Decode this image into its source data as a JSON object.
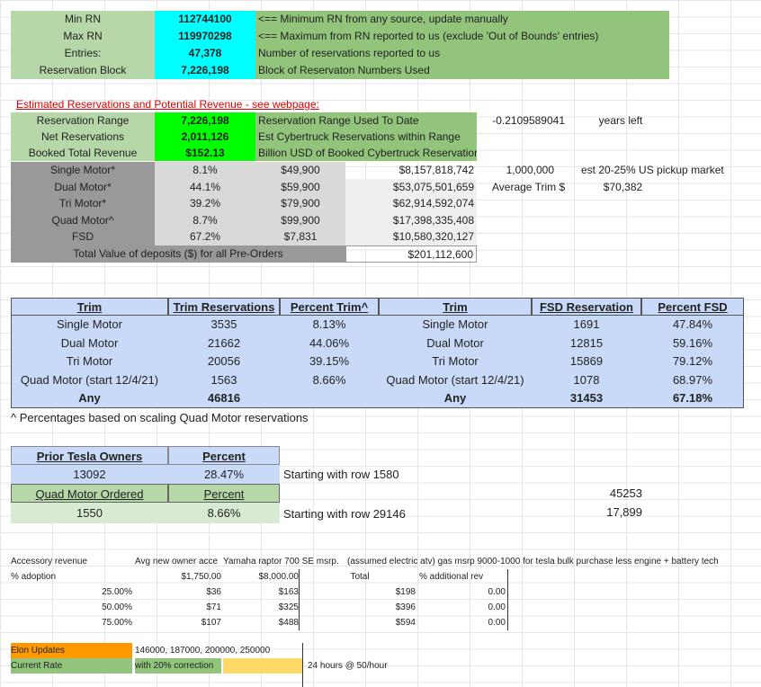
{
  "summary": {
    "rows": [
      {
        "label": "Min RN",
        "value": "112744100",
        "note": "<== Minimum RN from any source, update manually"
      },
      {
        "label": "Max RN",
        "value": "119970298",
        "note": "<== Maximum from RN reported to us (exclude 'Out of Bounds' entries)"
      },
      {
        "label": "Entries:",
        "value": "47,378",
        "note": "Number of reservations reported to us"
      },
      {
        "label": "Reservation Block",
        "value": "7,226,198",
        "note": "Block of Reservaton Numbers Used"
      }
    ]
  },
  "estimate": {
    "title": "Estimated Reservations and Potential Revenue - see webpage:",
    "rows": [
      {
        "label": "Reservation Range",
        "value": "7,226,198",
        "note": "Reservation Range Used To Date"
      },
      {
        "label": "Net Reservations",
        "value": "2,011,126",
        "note": "Est Cybertruck Reservations within Range"
      },
      {
        "label": "Booked Total Revenue",
        "value": "$152.13",
        "note": "Billion USD of Booked Cybertruck Reservation"
      }
    ],
    "side": {
      "years_value": "-0.2109589041",
      "years_label": "years left",
      "market_count": "1,000,000",
      "market_note": "est 20-25% US pickup market",
      "avg_trim_label": "Average Trim $",
      "avg_trim_value": "$70,382"
    },
    "trims": [
      {
        "name": "Single Motor*",
        "pct": "8.1%",
        "price": "$49,900",
        "revenue": "$8,157,818,742"
      },
      {
        "name": "Dual Motor*",
        "pct": "44.1%",
        "price": "$59,900",
        "revenue": "$53,075,501,659"
      },
      {
        "name": "Tri Motor*",
        "pct": "39.2%",
        "price": "$79,900",
        "revenue": "$62,914,592,074"
      },
      {
        "name": "Quad Motor^",
        "pct": "8.7%",
        "price": "$99,900",
        "revenue": "$17,398,335,408"
      },
      {
        "name": "FSD",
        "pct": "67.2%",
        "price": "$7,831",
        "revenue": "$10,580,320,127"
      }
    ],
    "deposits_label": "Total Value of deposits ($) for all Pre-Orders",
    "deposits_value": "$201,112,600"
  },
  "trim_table": {
    "headers": [
      "Trim",
      "Trim Reservations",
      "Percent Trim^",
      "Trim",
      "FSD Reservation",
      "Percent FSD"
    ],
    "rows": [
      [
        "Single Motor",
        "3535",
        "8.13%",
        "Single Motor",
        "1691",
        "47.84%"
      ],
      [
        "Dual Motor",
        "21662",
        "44.06%",
        "Dual Motor",
        "12815",
        "59.16%"
      ],
      [
        "Tri Motor",
        "20056",
        "39.15%",
        "Tri Motor",
        "15869",
        "79.12%"
      ],
      [
        "Quad Motor (start 12/4/21)",
        "1563",
        "8.66%",
        "Quad Motor (start 12/4/21)",
        "1078",
        "68.97%"
      ],
      [
        "Any",
        "46816",
        "",
        "Any",
        "31453",
        "67.18%"
      ]
    ],
    "footnote": "^ Percentages based on scaling Quad Motor reservations"
  },
  "owners": {
    "h1": "Prior Tesla Owners",
    "h2": "Percent",
    "v1": "13092",
    "v2": "28.47%",
    "note1": "Starting with row 1580",
    "h3": "Quad Motor Ordered",
    "h4": "Percent",
    "v3": "1550",
    "v4": "8.66%",
    "note2": "Starting with row 29146",
    "side1": "45253",
    "side2": "17,899"
  },
  "accessory": {
    "label1": "Accessory revenue",
    "label2": "% adoption",
    "col_a_header": "Avg new owner acce",
    "col_b_header": "Yamaha raptor 700 SE msrp.",
    "header_rest": "(assumed electric atv) gas msrp 9000-1000 for tesla bulk purchase less engine + battery tech",
    "col_a_value": "$1,750.00",
    "col_b_value": "$8,000.00",
    "total_label": "Total",
    "addl_label": "% additional rev",
    "rows": [
      [
        "25.00%",
        "$36",
        "$163",
        "$198",
        "0.00"
      ],
      [
        "50.00%",
        "$71",
        "$325",
        "$396",
        "0.00"
      ],
      [
        "75.00%",
        "$107",
        "$488",
        "$594",
        "0.00"
      ]
    ],
    "elon_label": "Elon Updates",
    "elon_value": "146000, 187000, 200000, 250000",
    "rate_label": "Current Rate",
    "rate_value": "with 20% correction",
    "rate_note": "24 hours @ 50/hour"
  },
  "colors": {
    "light_green": "#b6d7a8",
    "green": "#92c47c",
    "cyan": "#00ffff",
    "bright_green": "#00ff00",
    "gray": "#999999",
    "blue": "#c9daf8",
    "orange": "#ff9900",
    "yellow": "#ffd966"
  }
}
